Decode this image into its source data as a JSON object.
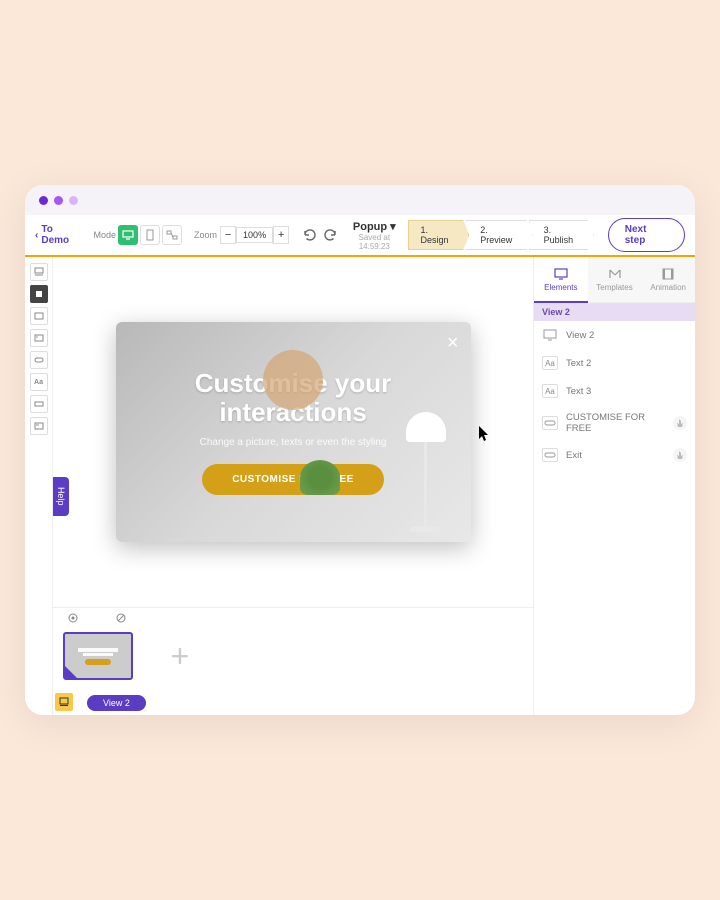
{
  "window": {
    "dots": [
      "#6d28d9",
      "#a855f7",
      "#d8b4fe"
    ]
  },
  "toolbar": {
    "back_label": "To Demo",
    "mode_label": "Mode",
    "zoom_label": "Zoom",
    "zoom_value": "100%",
    "popup_label": "Popup",
    "saved_label": "Saved at 14:59:23",
    "steps": [
      "1. Design",
      "2. Preview",
      "3. Publish"
    ],
    "active_step": 0,
    "next_label": "Next step"
  },
  "popup": {
    "title_line1": "Customise your",
    "title_line2": "interactions",
    "subtitle": "Change a picture, texts or even the styling",
    "cta_label": "CUSTOMISE FOR FREE"
  },
  "help_label": "Help",
  "bottom": {
    "view_chip": "View 2"
  },
  "panel": {
    "tabs": [
      "Elements",
      "Templates",
      "Animation"
    ],
    "active_tab": 0,
    "view_header": "View 2",
    "layers": [
      {
        "icon": "screen",
        "label": "View 2",
        "action": false
      },
      {
        "icon": "Aa",
        "label": "Text 2",
        "action": false
      },
      {
        "icon": "Aa",
        "label": "Text 3",
        "action": false
      },
      {
        "icon": "btn",
        "label": "CUSTOMISE FOR FREE",
        "action": true
      },
      {
        "icon": "btn",
        "label": "Exit",
        "action": true
      }
    ]
  }
}
